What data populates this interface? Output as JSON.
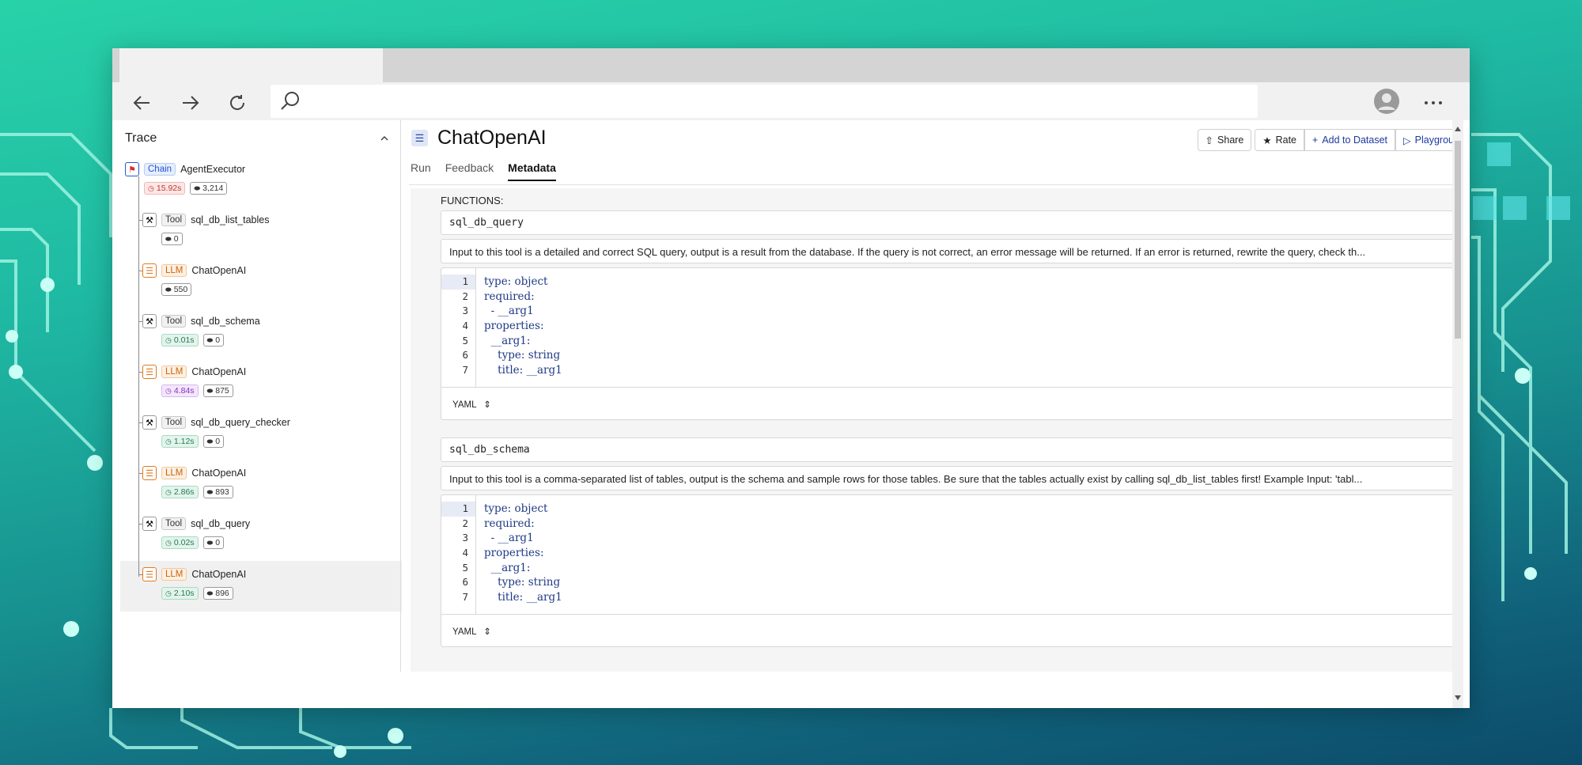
{
  "browser": {
    "back_icon": "arrow-left-icon",
    "forward_icon": "arrow-right-icon",
    "reload_icon": "reload-icon",
    "search_icon": "search-icon",
    "profile_icon": "avatar-icon",
    "more_icon": "ellipsis-icon"
  },
  "sidebar": {
    "title": "Trace",
    "items": [
      {
        "type": "Chain",
        "name": "AgentExecutor",
        "latency": "15.92s",
        "latency_color": "red",
        "tokens": "3,214"
      },
      {
        "type": "Tool",
        "name": "sql_db_list_tables",
        "latency": "",
        "tokens": "0"
      },
      {
        "type": "LLM",
        "name": "ChatOpenAI",
        "latency": "",
        "tokens": "550"
      },
      {
        "type": "Tool",
        "name": "sql_db_schema",
        "latency": "0.01s",
        "latency_color": "green",
        "tokens": "0"
      },
      {
        "type": "LLM",
        "name": "ChatOpenAI",
        "latency": "4.84s",
        "latency_color": "purple",
        "tokens": "875"
      },
      {
        "type": "Tool",
        "name": "sql_db_query_checker",
        "latency": "1.12s",
        "latency_color": "green",
        "tokens": "0"
      },
      {
        "type": "LLM",
        "name": "ChatOpenAI",
        "latency": "2.86s",
        "latency_color": "green",
        "tokens": "893"
      },
      {
        "type": "Tool",
        "name": "sql_db_query",
        "latency": "0.02s",
        "latency_color": "green",
        "tokens": "0"
      },
      {
        "type": "LLM",
        "name": "ChatOpenAI",
        "latency": "2.10s",
        "latency_color": "green",
        "tokens": "896"
      }
    ]
  },
  "main": {
    "title": "ChatOpenAI",
    "actions": {
      "share": "Share",
      "rate": "Rate",
      "add_to_dataset": "Add to Dataset",
      "playground": "Playgrou"
    },
    "tabs": [
      "Run",
      "Feedback",
      "Metadata"
    ],
    "active_tab": "Metadata",
    "functions_label": "FUNCTIONS:",
    "functions": [
      {
        "name": "sql_db_query",
        "description": "Input to this tool is a detailed and correct SQL query, output is a result from the database. If the query is not correct, an error message will be returned. If an error is returned, rewrite the query, check th...",
        "code_lines": [
          "type: object",
          "required:",
          "  - __arg1",
          "properties:",
          "  __arg1:",
          "    type: string",
          "    title: __arg1"
        ],
        "format": "YAML"
      },
      {
        "name": "sql_db_schema",
        "description": "Input to this tool is a comma-separated list of tables, output is the schema and sample rows for those tables. Be sure that the tables actually exist by calling sql_db_list_tables first! Example Input: 'tabl...",
        "code_lines": [
          "type: object",
          "required:",
          "  - __arg1",
          "properties:",
          "  __arg1:",
          "    type: string",
          "    title: __arg1"
        ],
        "format": "YAML"
      }
    ]
  },
  "line_numbers": [
    "1",
    "2",
    "3",
    "4",
    "5",
    "6",
    "7"
  ],
  "colors": {
    "chain": "#2457d6",
    "llm": "#e07a1f",
    "code": "#1f3a86",
    "accent": "#1d3a9e"
  }
}
